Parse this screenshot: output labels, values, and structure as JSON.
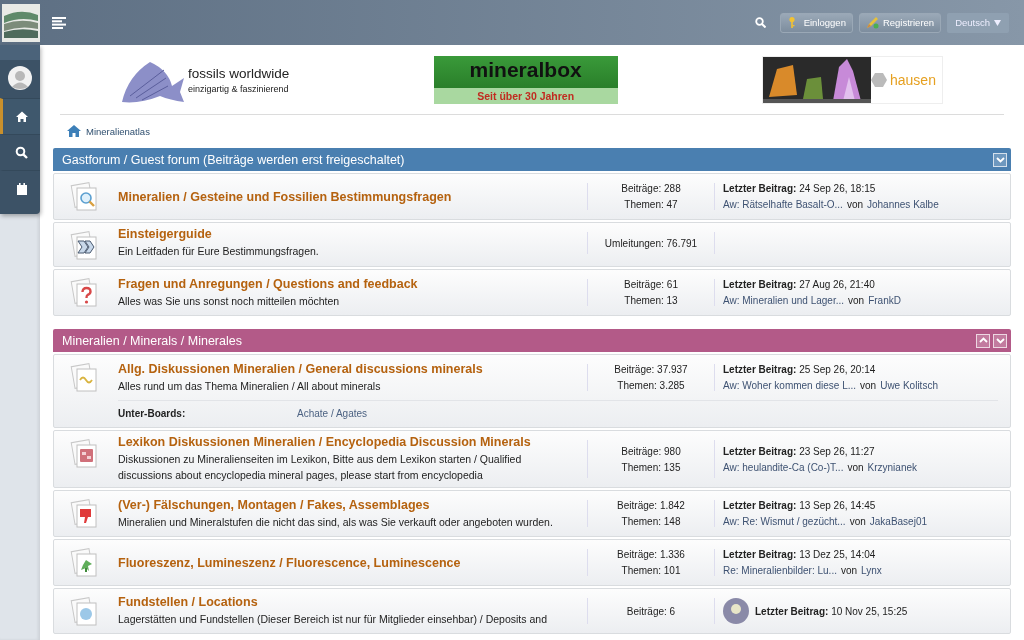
{
  "top_bar": {
    "buttons": [
      {
        "kind": "login",
        "label": "Einloggen"
      },
      {
        "kind": "register",
        "label": "Registrieren"
      }
    ],
    "language": "Deutsch"
  },
  "sidebar": {
    "items": [
      {
        "kind": "home",
        "selected": true
      },
      {
        "kind": "search",
        "selected": false
      },
      {
        "kind": "calendar",
        "selected": false
      }
    ]
  },
  "ads": [
    {
      "kind": "fossils",
      "title": "fossils worldwide",
      "tagline": "einzigartig & faszinierend"
    },
    {
      "kind": "mineralbox",
      "title": "mineralbox",
      "tagline": "Seit über 30 Jahren"
    },
    {
      "kind": "hausen",
      "title": "hausen"
    }
  ],
  "breadcrumb": [
    "Mineralienatlas"
  ],
  "categories": [
    {
      "title": "Gastforum / Guest forum (Beiträge werden erst freigeschaltet)",
      "color": "#4a7fb0",
      "buttons": [
        {
          "kind": "down"
        }
      ],
      "forums": [
        {
          "kind": "search",
          "title": "Mineralien / Gesteine und Fossilien Bestimmungsfragen",
          "stats": [
            "Beiträge: 288",
            "Themen: 47"
          ],
          "last_post": {
            "heading": "**Letzter Beitrag:** 24 Sep 26, 18:15",
            "topic": "Aw: Rätselhafte Basalt-O...",
            "by": "von",
            "author": "Johannes Kalbe"
          }
        },
        {
          "kind": "redirect",
          "title": "Einsteigerguide",
          "description": "Ein Leitfaden für Eure Bestimmungsfragen.",
          "stats": [
            "Umleitungen: 76.791"
          ]
        },
        {
          "kind": "question",
          "title": "Fragen und Anregungen / Questions and feedback",
          "description": "Alles was Sie uns sonst noch mitteilen möchten",
          "stats": [
            "Beiträge: 61",
            "Themen: 13"
          ],
          "last_post": {
            "heading": "**Letzter Beitrag:** 27 Aug 26, 21:40",
            "topic": "Aw: Mineralien und Lager...",
            "by": "von",
            "author": "FrankD"
          }
        }
      ]
    },
    {
      "title": "Mineralien / Minerals / Minerales",
      "color": "#b35a88",
      "buttons": [
        {
          "kind": "up"
        },
        {
          "kind": "down"
        }
      ],
      "forums": [
        {
          "kind": "wave",
          "title": "Allg. Diskussionen Mineralien / General discussions minerals",
          "description": "Alles rund um das Thema Mineralien / All about minerals",
          "stats": [
            "Beiträge: 37.937",
            "Themen: 3.285"
          ],
          "last_post": {
            "heading": "**Letzter Beitrag:** 25 Sep 26, 20:14",
            "topic": "Aw: Woher kommen diese L...",
            "by": "von",
            "author": "Uwe Kolitsch"
          },
          "subboards": {
            "label": "Unter-Boards:",
            "items": [
              "Achate / Agates"
            ]
          }
        },
        {
          "kind": "book",
          "title": "Lexikon Diskussionen Mineralien / Encyclopedia Discussion Minerals",
          "description": "Diskussionen zu Mineralienseiten im Lexikon, Bitte aus dem Lexikon starten / Qualified discussions about encyclopedia mineral pages, please start from encyclopedia",
          "stats": [
            "Beiträge: 980",
            "Themen: 135"
          ],
          "last_post": {
            "heading": "**Letzter Beitrag:** 23 Sep 26, 11:27",
            "topic": "Aw: heulandite-Ca (Co-)T...",
            "by": "von",
            "author": "Krzynianek"
          }
        },
        {
          "kind": "thumbsdown",
          "title": "(Ver-) Fälschungen, Montagen / Fakes, Assemblages",
          "description": "Mineralien und Mineralstufen die nicht das sind, als was Sie verkauft oder angeboten wurden.",
          "stats": [
            "Beiträge: 1.842",
            "Themen: 148"
          ],
          "last_post": {
            "heading": "**Letzter Beitrag:** 13 Sep 26, 14:45",
            "topic": "Aw: Re: Wismut / gezücht...",
            "by": "von",
            "author": "JakaBasej01"
          }
        },
        {
          "kind": "plant",
          "title": "Fluoreszenz, Lumineszenz / Fluorescence, Luminescence",
          "stats": [
            "Beiträge: 1.336",
            "Themen: 101"
          ],
          "last_post": {
            "heading": "**Letzter Beitrag:** 13 Dez 25, 14:04",
            "topic": "Re: Mineralienbilder: Lu...",
            "by": "von",
            "author": "Lynx"
          }
        },
        {
          "kind": "globe",
          "title": "Fundstellen / Locations",
          "description": "Lagerstätten und Fundstellen (Dieser Bereich ist nur für Mitglieder einsehbar) / Deposits and",
          "stats": [
            "Beiträge: 6"
          ],
          "last_post": {
            "heading": "**Letzter Beitrag:** 10 Nov 25, 15:25",
            "avatar": true
          }
        }
      ]
    }
  ]
}
